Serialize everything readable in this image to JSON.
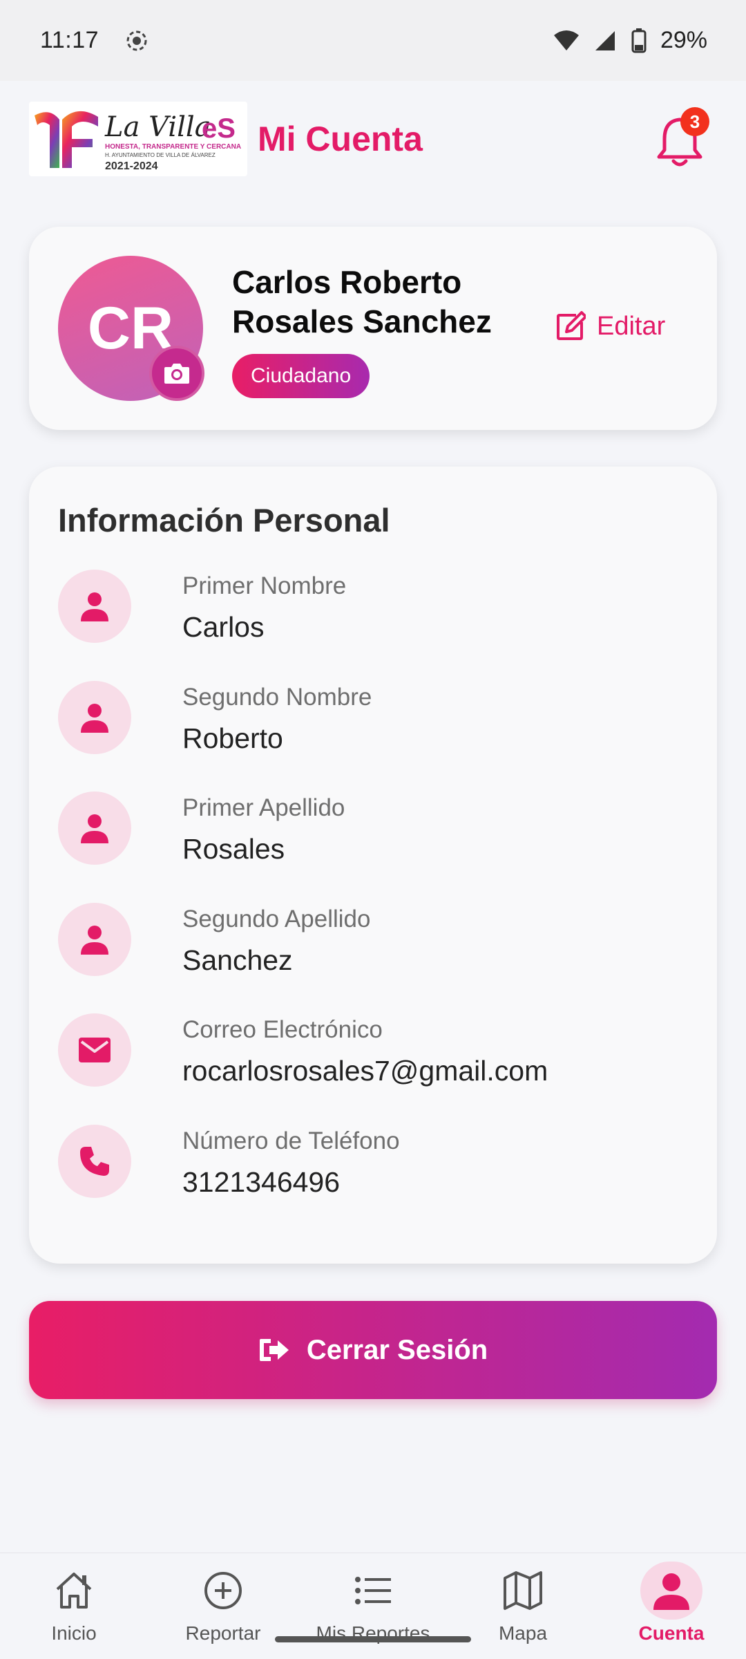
{
  "status_bar": {
    "time": "11:17",
    "battery": "29%",
    "icons": [
      "record-icon",
      "wifi-icon",
      "signal-icon",
      "battery-icon"
    ]
  },
  "header": {
    "logo_text": "La Villa eS",
    "logo_tagline": "HONESTA, TRANSPARENTE Y CERCANA",
    "logo_subtag": "H. AYUNTAMIENTO DE VILLA DE ÁLVAREZ",
    "logo_years": "2021-2024",
    "title": "Mi Cuenta",
    "notification_count": "3"
  },
  "profile": {
    "initials": "CR",
    "full_name": "Carlos  Roberto\nRosales  Sanchez",
    "role": "Ciudadano",
    "edit_label": "Editar"
  },
  "info": {
    "title": "Información Personal",
    "rows": [
      {
        "label": "Primer Nombre",
        "value": "Carlos",
        "icon": "person-icon"
      },
      {
        "label": "Segundo Nombre",
        "value": "Roberto",
        "icon": "person-icon"
      },
      {
        "label": "Primer Apellido",
        "value": "Rosales",
        "icon": "person-icon"
      },
      {
        "label": "Segundo Apellido",
        "value": "Sanchez",
        "icon": "person-icon"
      },
      {
        "label": "Correo Electrónico",
        "value": "rocarlosrosales7@gmail.com",
        "icon": "mail-icon"
      },
      {
        "label": "Número de Teléfono",
        "value": "3121346496",
        "icon": "phone-icon"
      }
    ]
  },
  "logout_label": "Cerrar Sesión",
  "nav": {
    "items": [
      {
        "label": "Inicio",
        "icon": "home-icon"
      },
      {
        "label": "Reportar",
        "icon": "add-circle-icon"
      },
      {
        "label": "Mis Reportes",
        "icon": "list-icon"
      },
      {
        "label": "Mapa",
        "icon": "map-icon"
      },
      {
        "label": "Cuenta",
        "icon": "user-icon",
        "active": true
      }
    ]
  },
  "colors": {
    "accent": "#e31b67",
    "gradient_end": "#a32bb0",
    "icon_bg": "#f8dde8"
  }
}
